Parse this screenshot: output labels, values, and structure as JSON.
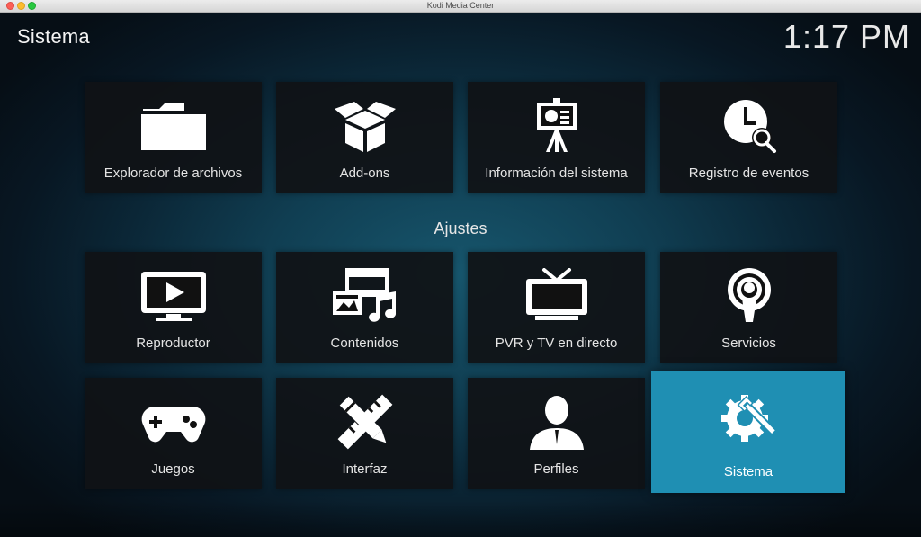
{
  "window": {
    "title": "Kodi Media Center"
  },
  "header": {
    "title": "Sistema",
    "clock": "1:17 PM"
  },
  "top_row": [
    {
      "label": "Explorador de archivos",
      "icon": "folder-icon"
    },
    {
      "label": "Add-ons",
      "icon": "box-icon"
    },
    {
      "label": "Información del sistema",
      "icon": "presentation-icon"
    },
    {
      "label": "Registro de eventos",
      "icon": "clock-search-icon"
    }
  ],
  "section": {
    "title": "Ajustes"
  },
  "settings": [
    {
      "label": "Reproductor",
      "icon": "monitor-play-icon"
    },
    {
      "label": "Contenidos",
      "icon": "media-icon"
    },
    {
      "label": "PVR y TV en directo",
      "icon": "tv-icon"
    },
    {
      "label": "Servicios",
      "icon": "broadcast-icon"
    },
    {
      "label": "Juegos",
      "icon": "gamepad-icon"
    },
    {
      "label": "Interfaz",
      "icon": "pencil-ruler-icon"
    },
    {
      "label": "Perfiles",
      "icon": "user-icon"
    },
    {
      "label": "Sistema",
      "icon": "gear-wrench-icon",
      "focused": true
    }
  ],
  "colors": {
    "focus": "#1f8fb3",
    "tile": "#101216",
    "background": "#103e52"
  }
}
